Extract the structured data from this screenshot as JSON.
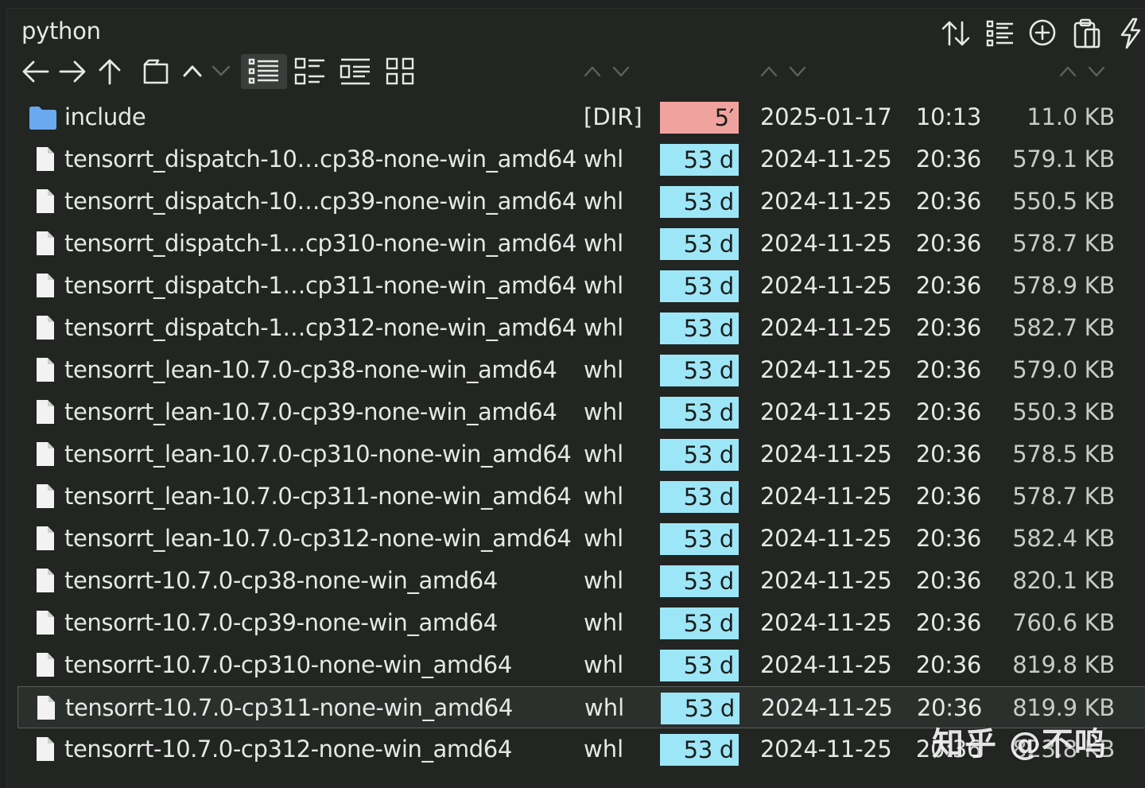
{
  "window": {
    "title": "python"
  },
  "toolbar": {
    "top_icons": [
      "sort-icon",
      "list-options-icon",
      "add-circle-icon",
      "clipboard-icon",
      "lightning-icon"
    ],
    "nav_icons": [
      "back-arrow-icon",
      "forward-arrow-icon",
      "up-arrow-icon",
      "new-tab-icon",
      "chevron-up-icon",
      "chevron-down-icon"
    ],
    "view_icons": [
      "list-view-icon",
      "detail-view-icon",
      "tree-view-icon",
      "grid-view-icon"
    ],
    "active_view": "list-view-icon"
  },
  "colors": {
    "background": "#222522",
    "age_recent": "#f0a39e",
    "age_old": "#9de6f7",
    "folder": "#6aa8f0",
    "selected_row": "#2c302d"
  },
  "files": [
    {
      "name": "include",
      "type": "[DIR]",
      "age": "5′",
      "age_kind": "recent",
      "date": "2025-01-17",
      "time": "10:13",
      "size": "11.0 KB",
      "is_dir": true
    },
    {
      "name": "tensorrt_dispatch-10…cp38-none-win_amd64",
      "type": "whl",
      "age": "53 d",
      "age_kind": "old",
      "date": "2024-11-25",
      "time": "20:36",
      "size": "579.1 KB"
    },
    {
      "name": "tensorrt_dispatch-10…cp39-none-win_amd64",
      "type": "whl",
      "age": "53 d",
      "age_kind": "old",
      "date": "2024-11-25",
      "time": "20:36",
      "size": "550.5 KB"
    },
    {
      "name": "tensorrt_dispatch-1…cp310-none-win_amd64",
      "type": "whl",
      "age": "53 d",
      "age_kind": "old",
      "date": "2024-11-25",
      "time": "20:36",
      "size": "578.7 KB"
    },
    {
      "name": "tensorrt_dispatch-1…cp311-none-win_amd64",
      "type": "whl",
      "age": "53 d",
      "age_kind": "old",
      "date": "2024-11-25",
      "time": "20:36",
      "size": "578.9 KB"
    },
    {
      "name": "tensorrt_dispatch-1…cp312-none-win_amd64",
      "type": "whl",
      "age": "53 d",
      "age_kind": "old",
      "date": "2024-11-25",
      "time": "20:36",
      "size": "582.7 KB"
    },
    {
      "name": "tensorrt_lean-10.7.0-cp38-none-win_amd64",
      "type": "whl",
      "age": "53 d",
      "age_kind": "old",
      "date": "2024-11-25",
      "time": "20:36",
      "size": "579.0 KB"
    },
    {
      "name": "tensorrt_lean-10.7.0-cp39-none-win_amd64",
      "type": "whl",
      "age": "53 d",
      "age_kind": "old",
      "date": "2024-11-25",
      "time": "20:36",
      "size": "550.3 KB"
    },
    {
      "name": "tensorrt_lean-10.7.0-cp310-none-win_amd64",
      "type": "whl",
      "age": "53 d",
      "age_kind": "old",
      "date": "2024-11-25",
      "time": "20:36",
      "size": "578.5 KB"
    },
    {
      "name": "tensorrt_lean-10.7.0-cp311-none-win_amd64",
      "type": "whl",
      "age": "53 d",
      "age_kind": "old",
      "date": "2024-11-25",
      "time": "20:36",
      "size": "578.7 KB"
    },
    {
      "name": "tensorrt_lean-10.7.0-cp312-none-win_amd64",
      "type": "whl",
      "age": "53 d",
      "age_kind": "old",
      "date": "2024-11-25",
      "time": "20:36",
      "size": "582.4 KB"
    },
    {
      "name": "tensorrt-10.7.0-cp38-none-win_amd64",
      "type": "whl",
      "age": "53 d",
      "age_kind": "old",
      "date": "2024-11-25",
      "time": "20:36",
      "size": "820.1 KB"
    },
    {
      "name": "tensorrt-10.7.0-cp39-none-win_amd64",
      "type": "whl",
      "age": "53 d",
      "age_kind": "old",
      "date": "2024-11-25",
      "time": "20:36",
      "size": "760.6 KB"
    },
    {
      "name": "tensorrt-10.7.0-cp310-none-win_amd64",
      "type": "whl",
      "age": "53 d",
      "age_kind": "old",
      "date": "2024-11-25",
      "time": "20:36",
      "size": "819.8 KB"
    },
    {
      "name": "tensorrt-10.7.0-cp311-none-win_amd64",
      "type": "whl",
      "age": "53 d",
      "age_kind": "old",
      "date": "2024-11-25",
      "time": "20:36",
      "size": "819.9 KB",
      "selected": true
    },
    {
      "name": "tensorrt-10.7.0-cp312-none-win_amd64",
      "type": "whl",
      "age": "53 d",
      "age_kind": "old",
      "date": "2024-11-25",
      "time": "20:36",
      "size": "823.8 KB"
    }
  ],
  "watermark": {
    "text": "知乎 @不鸣"
  }
}
